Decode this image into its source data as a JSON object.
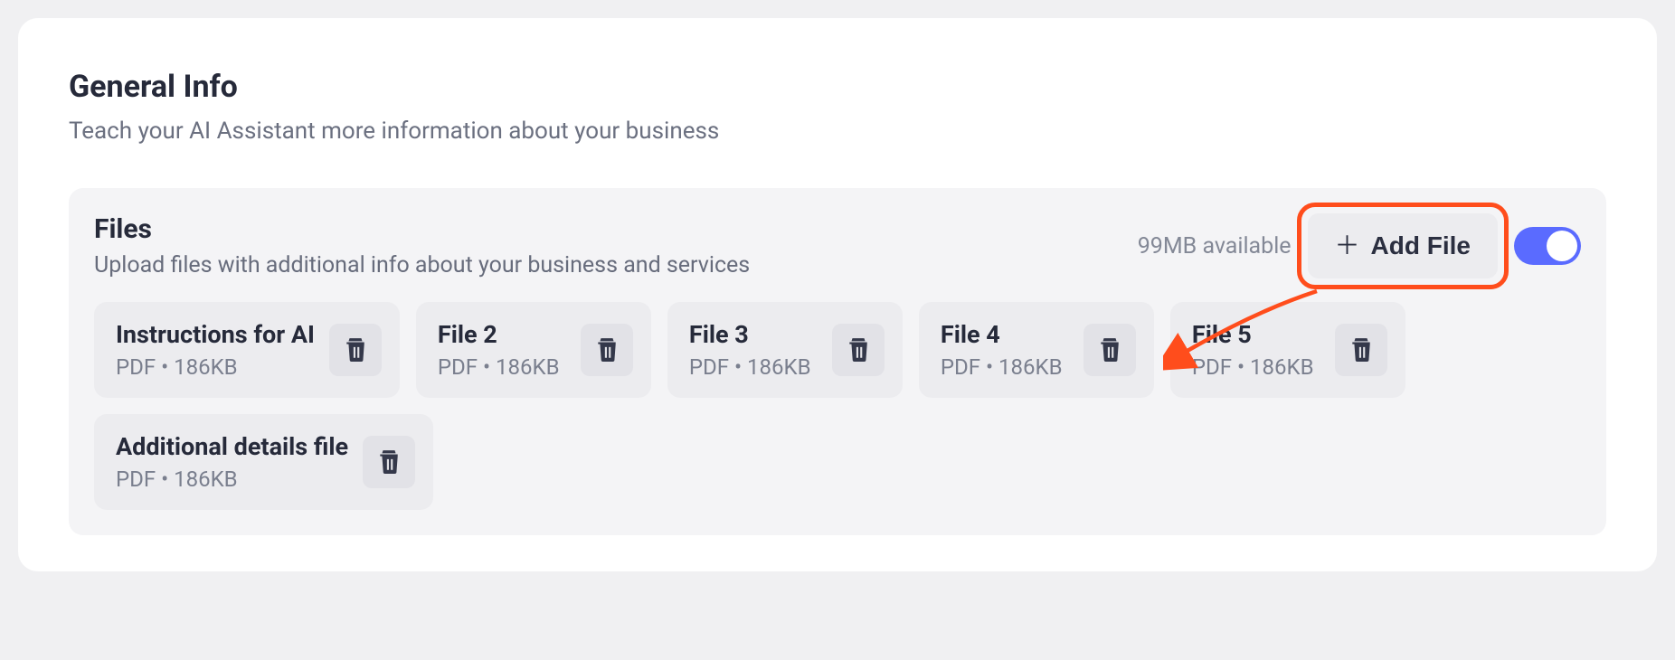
{
  "header": {
    "title": "General Info",
    "subtitle": "Teach your AI Assistant more information about your business"
  },
  "files_panel": {
    "title": "Files",
    "subtitle": "Upload files with additional info about your business and services",
    "storage_available": "99MB available",
    "add_button_label": "Add File",
    "toggle_on": true,
    "files": [
      {
        "name": "Instructions for AI",
        "meta": "PDF • 186KB"
      },
      {
        "name": "File 2",
        "meta": "PDF • 186KB"
      },
      {
        "name": "File 3",
        "meta": "PDF • 186KB"
      },
      {
        "name": "File 4",
        "meta": "PDF • 186KB"
      },
      {
        "name": "File 5",
        "meta": "PDF • 186KB"
      },
      {
        "name": "Additional details file",
        "meta": "PDF • 186KB"
      }
    ]
  },
  "annotation": {
    "highlight": "add-file-button",
    "arrow": true
  },
  "colors": {
    "accent": "#5a6bff",
    "annotation": "#ff4d1c"
  }
}
